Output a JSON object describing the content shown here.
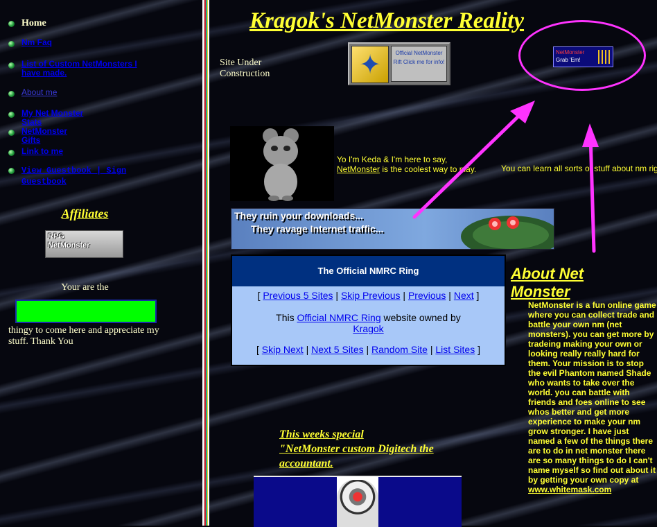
{
  "colors": {
    "accent": "#ffff33",
    "link": "#0000ee",
    "counter": "#00ff00",
    "annotation": "#ff33ff"
  },
  "nav": {
    "home": "Home",
    "items": [
      {
        "label": "Nm Faq"
      },
      {
        "label": "List of Custom NetMonsters I have made."
      },
      {
        "label": "About me"
      },
      {
        "label": "My Net Monster Stats"
      },
      {
        "label": "NetMonster Gifts"
      },
      {
        "label": "Link to me"
      },
      {
        "label": "View Guestbook | Sign Guestbook"
      }
    ]
  },
  "affiliates": {
    "title": "Affiliates",
    "badge_line1": "RPG",
    "badge_line2": "NetMonster"
  },
  "counter": {
    "before": "Your are the",
    "after": "thingy to come here and appreciate my stuff. Thank You"
  },
  "header": {
    "title": "Kragok's NetMonster Reality",
    "construction": "Site Under Construction"
  },
  "rift": {
    "text": "Official NetMonster Rift Click me for info!",
    "icon": "star-icon"
  },
  "grab": {
    "line1": "NetMonster",
    "line2": "Grab 'Em!"
  },
  "intro": {
    "before": "Yo I'm Keda & I'm here to say,",
    "link": "NetMonster",
    "after": "is the coolest way to play."
  },
  "learn": {
    "text": "You can learn all sorts of stuff about nm right here in this web site and every page has a net monster cage for you to catch nm"
  },
  "banner": {
    "line1": "They ruin your downloads...",
    "line2": "They ravage Internet traffic..."
  },
  "ring": {
    "title": "The Official NMRC Ring",
    "nav1": [
      "Previous 5 Sites",
      "Skip Previous",
      "Previous",
      "Next"
    ],
    "owned_this": "This",
    "owned_link": "Official NMRC Ring",
    "owned_mid": "website owned by",
    "owner": "Kragok",
    "nav2": [
      "Skip Next",
      "Next 5 Sites",
      "Random Site",
      "List Sites"
    ]
  },
  "about": {
    "title": "About Net Monster",
    "body": "NetMonster is a fun online game where you can collect trade and battle your own nm (net monsters). you can get more by tradeing making your own or looking really really hard for them. Your mission is to stop the evil Phantom named Shade who wants to take over the world. you can battle with friends and foes online to see whos better and get more experience to make your nm grow stronger. I have just named a few of the things there are to do in net monster there are so many things to do I can't name myself so find out about it by getting your own copy at",
    "link": "www.whitemask.com"
  },
  "special": {
    "line1": "This weeks special",
    "line2": "\"NetMonster custom Digitech the accountant."
  }
}
